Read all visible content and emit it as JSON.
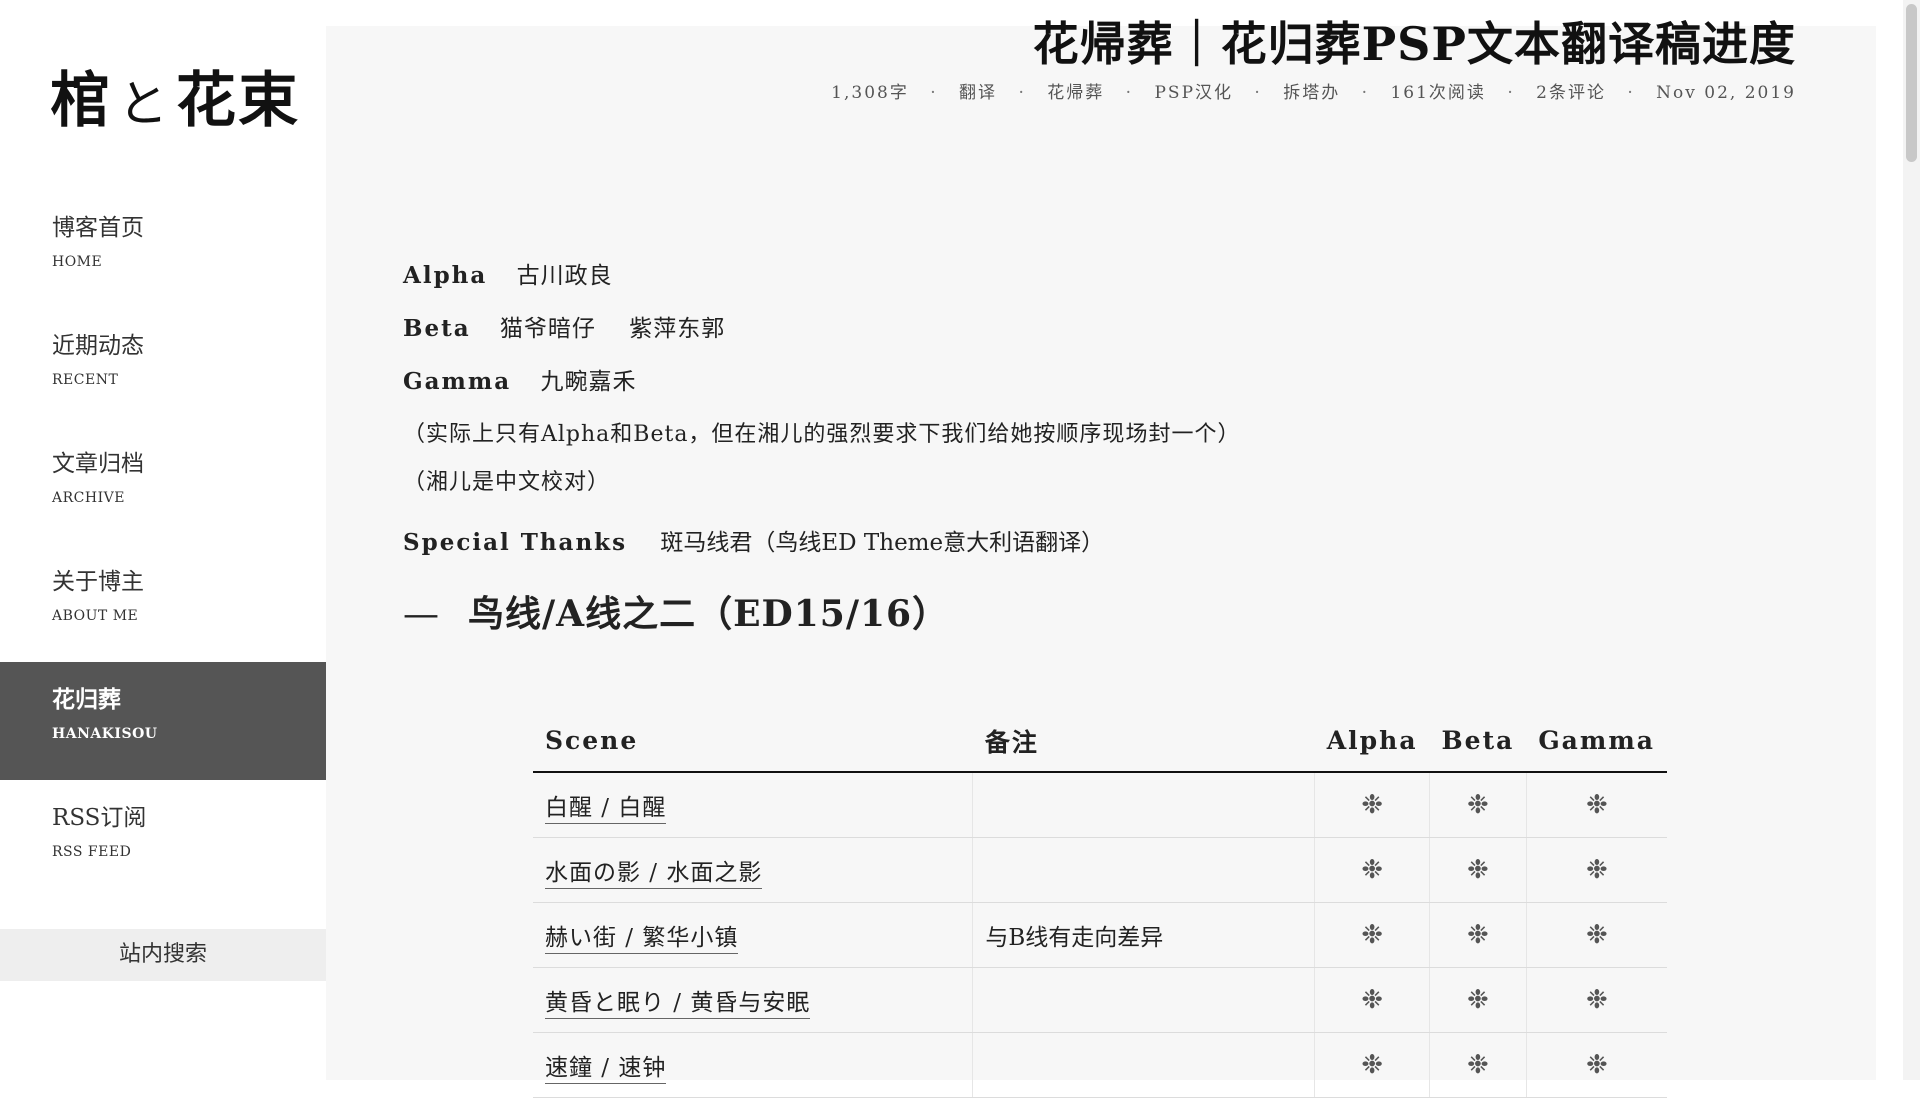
{
  "sidebar": {
    "logo": {
      "part1": "棺",
      "part2": "と",
      "part3": "花束"
    },
    "nav": [
      {
        "zh": "博客首页",
        "en": "HOME"
      },
      {
        "zh": "近期动态",
        "en": "RECENT"
      },
      {
        "zh": "文章归档",
        "en": "ARCHIVE"
      },
      {
        "zh": "关于博主",
        "en": "ABOUT ME"
      },
      {
        "zh": "花归葬",
        "en": "HANAKISOU",
        "active": true
      },
      {
        "zh": "RSS订阅",
        "en": "RSS FEED"
      }
    ],
    "search_label": "站内搜索"
  },
  "post": {
    "title": "花帰葬｜花归葬PSP文本翻译稿进度",
    "meta": {
      "words": "1,308字",
      "category": "翻译",
      "tag1": "花帰葬",
      "tag2": "PSP汉化",
      "tag3": "拆塔办",
      "reads": "161次阅读",
      "comments": "2条评论",
      "date": "Nov 02, 2019",
      "separator": "·"
    },
    "credits": {
      "alpha": {
        "role": "Alpha",
        "names": [
          "古川政良"
        ]
      },
      "beta": {
        "role": "Beta",
        "names": [
          "猫爷暗仔",
          "紫萍东郭"
        ]
      },
      "gamma": {
        "role": "Gamma",
        "names": [
          "九畹嘉禾"
        ]
      }
    },
    "notes": [
      "（实际上只有Alpha和Beta，但在湘儿的强烈要求下我们给她按顺序现场封一个）",
      "（湘儿是中文校对）"
    ],
    "thanks": {
      "role": "Special Thanks",
      "text": "斑马线君（鸟线ED Theme意大利语翻译）"
    },
    "section": {
      "dash": "—",
      "title": "鸟线/A线之二（ED15/16）"
    }
  },
  "table": {
    "headers": {
      "scene": "Scene",
      "note": "备注",
      "alpha": "Alpha",
      "beta": "Beta",
      "gamma": "Gamma"
    },
    "mark": "❉",
    "rows": [
      {
        "scene": "白醒 / 白醒",
        "note": ""
      },
      {
        "scene": "水面の影 / 水面之影",
        "note": ""
      },
      {
        "scene": "赫い街 / 繁华小镇",
        "note": "与B线有走向差异"
      },
      {
        "scene": "黄昏と眠り / 黄昏与安眠",
        "note": ""
      },
      {
        "scene": "速鐘 / 速钟",
        "note": ""
      }
    ]
  }
}
